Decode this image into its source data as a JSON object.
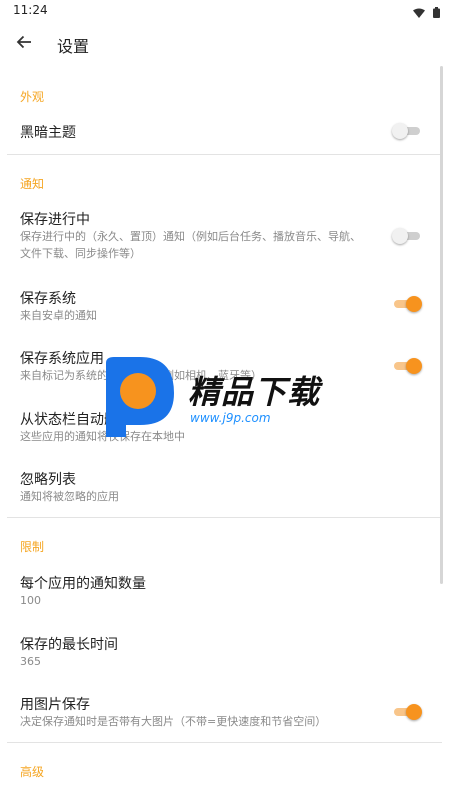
{
  "status_bar": {
    "time": "11:24"
  },
  "toolbar": {
    "title": "设置"
  },
  "sections": {
    "appearance": {
      "header": "外观",
      "dark_theme": {
        "title": "黑暗主题",
        "enabled": false
      }
    },
    "notifications": {
      "header": "通知",
      "save_ongoing": {
        "title": "保存进行中",
        "subtitle": "保存进行中的（永久、置顶）通知（例如后台任务、播放音乐、导航、文件下载、同步操作等）",
        "enabled": false
      },
      "save_system": {
        "title": "保存系统",
        "subtitle": "来自安卓的通知",
        "enabled": true
      },
      "save_system_apps": {
        "title": "保存系统应用",
        "subtitle": "来自标记为系统的应用程序（例如相机、蓝牙等）",
        "enabled": true
      },
      "auto_remove": {
        "title": "从状态栏自动删除",
        "subtitle": "这些应用的通知将仅保存在本地中"
      },
      "ignore_list": {
        "title": "忽略列表",
        "subtitle": "通知将被忽略的应用"
      }
    },
    "limits": {
      "header": "限制",
      "per_app_count": {
        "title": "每个应用的通知数量",
        "value": "100"
      },
      "max_age": {
        "title": "保存的最长时间",
        "value": "365"
      },
      "save_images": {
        "title": "用图片保存",
        "subtitle": "决定保存通知时是否带有大图片（不带=更快速度和节省空间）",
        "enabled": true
      }
    },
    "advanced": {
      "header": "高级"
    }
  },
  "watermark": {
    "text": "精品下载",
    "url": "www.j9p.com"
  },
  "colors": {
    "accent": "#f7931e",
    "section_header": "#f5a623"
  }
}
